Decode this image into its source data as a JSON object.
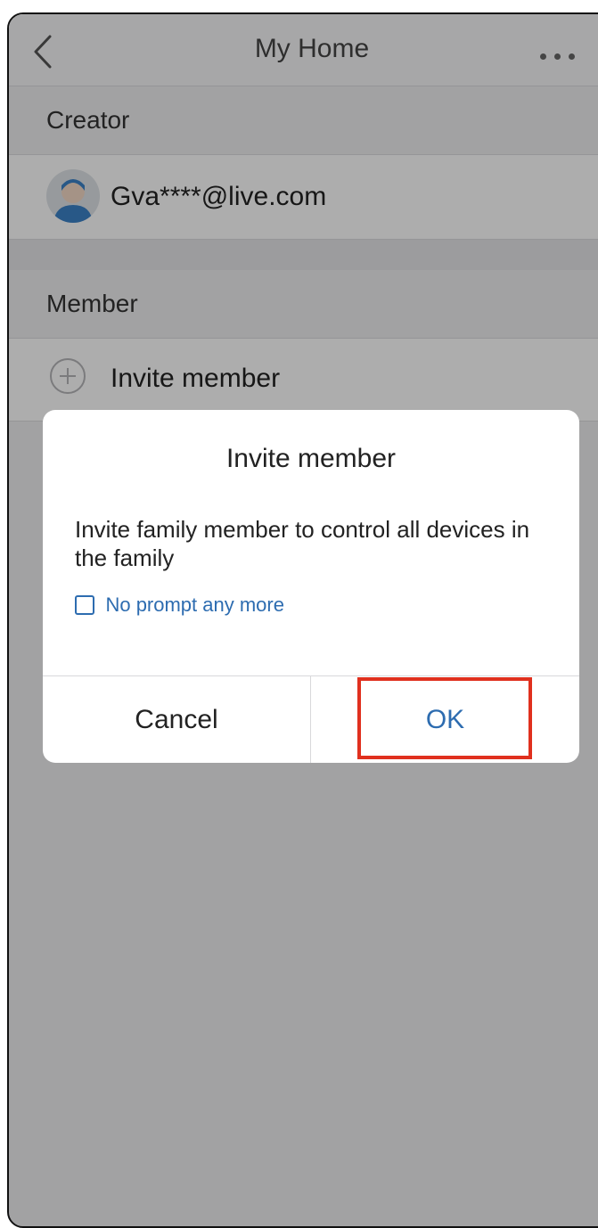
{
  "navbar": {
    "title": "My Home",
    "back_icon": "chevron-left-icon",
    "more_icon": "more-dots-icon"
  },
  "creator_section": {
    "header": "Creator",
    "email": "Gva****@live.com",
    "avatar_icon": "user-avatar-icon"
  },
  "member_section": {
    "header": "Member",
    "invite_label": "Invite member",
    "invite_icon": "plus-circle-icon"
  },
  "dialog": {
    "title": "Invite member",
    "message": "Invite family member to control all devices in the family",
    "checkbox_label": "No prompt any more",
    "checkbox_checked": false,
    "cancel_label": "Cancel",
    "ok_label": "OK"
  },
  "colors": {
    "accent": "#2d6cb0",
    "highlight_box": "#e0301e"
  }
}
